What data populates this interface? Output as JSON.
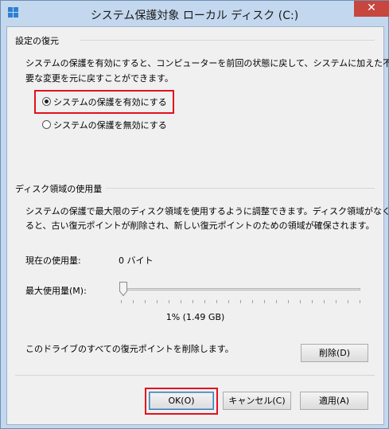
{
  "window": {
    "title": "システム保護対象 ローカル ディスク (C:)",
    "close_label": "✕"
  },
  "restore": {
    "heading": "設定の復元",
    "description_line1": "システムの保護を有効にすると、コンピューターを前回の状態に戻して、システムに加えた不",
    "description_line2": "要な変更を元に戻すことができます。",
    "option_enable": "システムの保護を有効にする",
    "option_disable": "システムの保護を無効にする",
    "selected": "enable"
  },
  "disk": {
    "heading": "ディスク領域の使用量",
    "description_line1": "システムの保護で最大限のディスク領域を使用するように調整できます。ディスク領域がなくな",
    "description_line2": "ると、古い復元ポイントが削除され、新しい復元ポイントのための領域が確保されます。",
    "current_usage_label": "現在の使用量:",
    "current_usage_value": "0 バイト",
    "max_usage_label": "最大使用量(M):",
    "max_usage_percent": 1,
    "max_usage_readout": "1% (1.49 GB)",
    "delete_text": "このドライブのすべての復元ポイントを削除します。",
    "delete_button": "削除(D)"
  },
  "buttons": {
    "ok": "OK(O)",
    "cancel": "キャンセル(C)",
    "apply": "適用(A)"
  },
  "colors": {
    "highlight": "#e3101f",
    "close_button": "#c7463d"
  }
}
